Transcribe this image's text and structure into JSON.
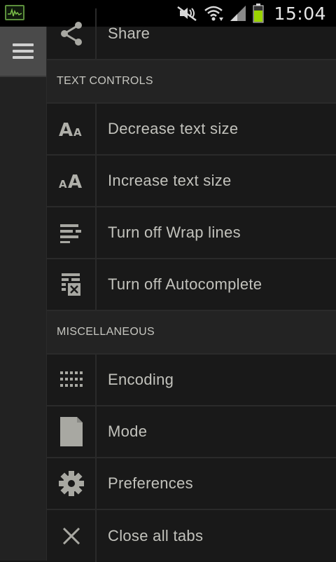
{
  "status_bar": {
    "time": "15:04",
    "icons": [
      "activity-monitor-icon",
      "mute-icon",
      "wifi-icon",
      "signal-icon",
      "battery-icon"
    ],
    "battery_color": "#9bd400"
  },
  "rail": {
    "menu_button_icon": "hamburger-icon"
  },
  "menu": {
    "share_label": "Share",
    "section_text_controls": "TEXT CONTROLS",
    "decrease_text_label": "Decrease text size",
    "increase_text_label": "Increase text size",
    "wrap_lines_label": "Turn off Wrap lines",
    "autocomplete_label": "Turn off Autocomplete",
    "section_misc": "MISCELLANEOUS",
    "encoding_label": "Encoding",
    "mode_label": "Mode",
    "preferences_label": "Preferences",
    "close_tabs_label": "Close all tabs",
    "decrease_icon_text": "AA",
    "increase_icon_text": "AA"
  },
  "colors": {
    "menu_bg": "#191919",
    "section_bg": "#232323",
    "text": "#c2c2bc",
    "icon": "#a8a8a2"
  }
}
